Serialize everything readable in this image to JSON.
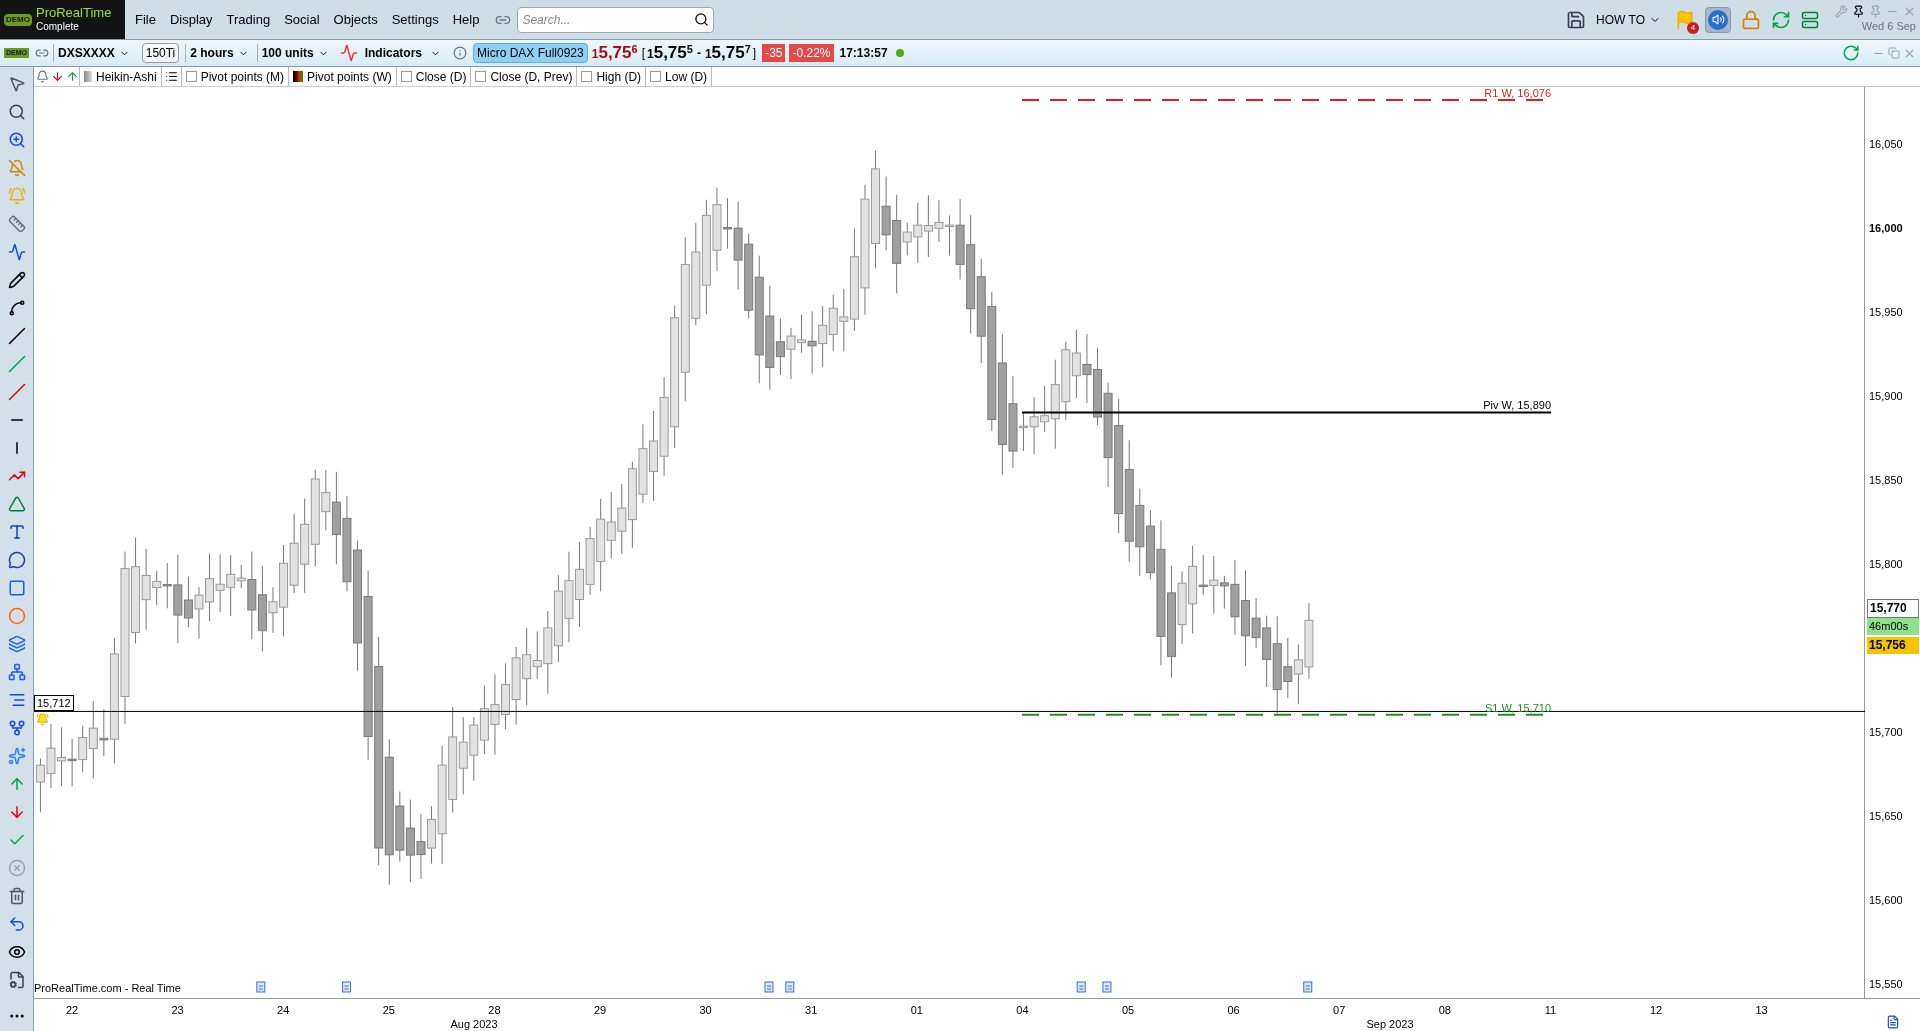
{
  "app": {
    "badge": "DEMO",
    "name": "ProRealTime",
    "edition": "Complete"
  },
  "menu": [
    "File",
    "Display",
    "Trading",
    "Social",
    "Objects",
    "Settings",
    "Help"
  ],
  "search": {
    "placeholder": "Search..."
  },
  "top_right": {
    "howto": "HOW TO",
    "flag_count": "4",
    "sound_on": true,
    "date": "Wed 6 Sep"
  },
  "toolbar": {
    "badge": "DEMO",
    "ticker": "DXSXXXX",
    "ticks": "150Ti",
    "period": "2 hours",
    "units": "100 units",
    "indicators": "Indicators",
    "instrument": "Micro DAX Full0923",
    "last": {
      "lead": "1",
      "main": "5,75",
      "sup": "6"
    },
    "open_bracket": "[",
    "bid": {
      "lead": "1",
      "main": "5,75",
      "sup": "5"
    },
    "dash": "-",
    "ask": {
      "lead": "1",
      "main": "5,75",
      "sup": "7"
    },
    "close_bracket": "]",
    "change": "-35",
    "change_pct": "-0.22%",
    "time": "17:13:57",
    "connected": true
  },
  "indicator_row": [
    {
      "kind": "candles",
      "label": "Heikin-Ashi"
    },
    {
      "kind": "list"
    },
    {
      "kind": "checkbox",
      "label": "Pivot points (M)",
      "checked": false
    },
    {
      "kind": "pivots",
      "label": "Pivot points (W)"
    },
    {
      "kind": "checkbox",
      "label": "Close (D)",
      "checked": false
    },
    {
      "kind": "checkbox",
      "label": "Close (D, Prev)",
      "checked": false
    },
    {
      "kind": "checkbox",
      "label": "High (D)",
      "checked": false
    },
    {
      "kind": "checkbox",
      "label": "Low (D)",
      "checked": false
    }
  ],
  "chart": {
    "levels": [
      {
        "label": "R1 W, 16,076",
        "kind": "dashed",
        "color": "#e02020"
      },
      {
        "label": "Piv W, 15,890",
        "kind": "solid",
        "color": "#000000"
      },
      {
        "label": "S1 W, 15,710",
        "kind": "dashed",
        "color": "#209020"
      }
    ],
    "alert_line": {
      "label": "15,712"
    },
    "source": "ProRealTime.com - Real Time"
  },
  "price_axis": {
    "ticks": [
      {
        "label": "16,050",
        "major": false
      },
      {
        "label": "16,000",
        "major": true
      },
      {
        "label": "15,950",
        "major": false
      },
      {
        "label": "15,900",
        "major": false
      },
      {
        "label": "15,850",
        "major": false
      },
      {
        "label": "15,800",
        "major": false
      },
      {
        "label": "15,700",
        "major": false
      },
      {
        "label": "15,650",
        "major": false
      },
      {
        "label": "15,600",
        "major": false
      },
      {
        "label": "15,550",
        "major": false
      }
    ],
    "badges": [
      {
        "kind": "high",
        "label": "15,770"
      },
      {
        "kind": "timer",
        "label": "46m00s"
      },
      {
        "kind": "price",
        "label": "15,756"
      }
    ]
  },
  "date_axis": {
    "days": [
      "22",
      "23",
      "24",
      "25",
      "28",
      "29",
      "30",
      "31",
      "01",
      "04",
      "05",
      "06",
      "07",
      "08",
      "11",
      "12",
      "13"
    ],
    "months": [
      "Aug 2023",
      "Sep 2023"
    ]
  }
}
